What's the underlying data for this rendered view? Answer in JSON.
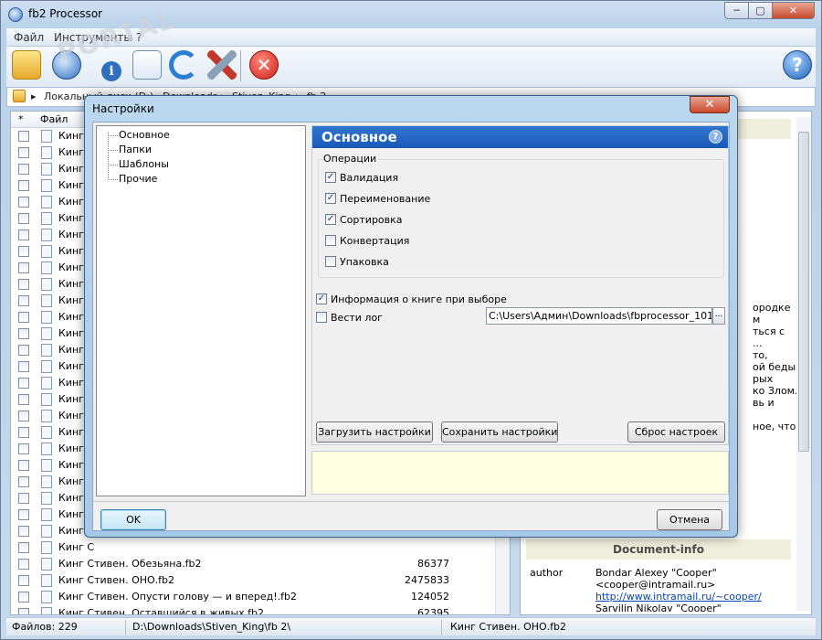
{
  "window": {
    "title": "fb2 Processor",
    "min": "─",
    "max": "▢",
    "close": "✕"
  },
  "menu": [
    "Файл",
    "Инструменты",
    "?"
  ],
  "toolbar": {
    "info": "i",
    "stop": "✕",
    "help": "?"
  },
  "address": {
    "crumbs": [
      "Локальный диск (D:)",
      "Downloads",
      "Stiven_King",
      "fb 2"
    ],
    "sep": "▸"
  },
  "filelist": {
    "headers": {
      "check": "*",
      "name": "Файл"
    },
    "rows": [
      {
        "name": "Кинг С",
        "size": ""
      },
      {
        "name": "Кинг С",
        "size": ""
      },
      {
        "name": "Кинг С",
        "size": ""
      },
      {
        "name": "Кинг С",
        "size": ""
      },
      {
        "name": "Кинг С",
        "size": ""
      },
      {
        "name": "Кинг С",
        "size": ""
      },
      {
        "name": "Кинг С",
        "size": ""
      },
      {
        "name": "Кинг С",
        "size": ""
      },
      {
        "name": "Кинг С",
        "size": ""
      },
      {
        "name": "Кинг С",
        "size": ""
      },
      {
        "name": "Кинг С",
        "size": ""
      },
      {
        "name": "Кинг С",
        "size": ""
      },
      {
        "name": "Кинг С",
        "size": ""
      },
      {
        "name": "Кинг С",
        "size": ""
      },
      {
        "name": "Кинг С",
        "size": ""
      },
      {
        "name": "Кинг С",
        "size": ""
      },
      {
        "name": "Кинг С",
        "size": ""
      },
      {
        "name": "Кинг С",
        "size": ""
      },
      {
        "name": "Кинг С",
        "size": ""
      },
      {
        "name": "Кинг С",
        "size": ""
      },
      {
        "name": "Кинг С",
        "size": ""
      },
      {
        "name": "Кинг С",
        "size": ""
      },
      {
        "name": "Кинг С",
        "size": ""
      },
      {
        "name": "Кинг С",
        "size": ""
      },
      {
        "name": "Кинг С",
        "size": ""
      },
      {
        "name": "Кинг С",
        "size": ""
      },
      {
        "name": "Кинг Стивен. Обезьяна.fb2",
        "size": "86377"
      },
      {
        "name": "Кинг Стивен. ОНО.fb2",
        "size": "2475833"
      },
      {
        "name": "Кинг Стивен. Опусти голову — и вперед!.fb2",
        "size": "124052"
      },
      {
        "name": "Кинг Стивен. Оставшийся в живых.fb2",
        "size": "62395"
      }
    ]
  },
  "rightpanel": {
    "lines": [
      "ородке",
      "м",
      "ться с",
      "...",
      "то,",
      "ой беды.",
      "рых",
      "ко Злом.",
      "вь и",
      "",
      "ное, что"
    ],
    "docinfo_title": "Document-info",
    "author_label": "author",
    "author_lines": [
      "Bondar Alexey \"Cooper\"",
      "<cooper@intramail.ru>",
      "http://www.intramail.ru/~cooper/",
      "Sarvilin Nikolay \"Cooper\""
    ]
  },
  "status": {
    "files": "Файлов: 229",
    "path": "D:\\Downloads\\Stiven_King\\fb 2\\",
    "current": "Кинг Стивен. ОНО.fb2"
  },
  "dialog": {
    "title": "Настройки",
    "close": "✕",
    "tree": [
      "Основное",
      "Папки",
      "Шаблоны",
      "Прочие"
    ],
    "section_title": "Основное",
    "section_help": "?",
    "group_label": "Операции",
    "operations": [
      {
        "label": "Валидация",
        "checked": true
      },
      {
        "label": "Переименование",
        "checked": true
      },
      {
        "label": "Сортировка",
        "checked": true
      },
      {
        "label": "Конвертация",
        "checked": false
      },
      {
        "label": "Упаковка",
        "checked": false
      }
    ],
    "book_info": {
      "label": "Информация о книге при выборе",
      "checked": true
    },
    "log": {
      "label": "Вести лог",
      "checked": false,
      "path": "C:\\Users\\Админ\\Downloads\\fbprocessor_101\\log.txt",
      "browse": "..."
    },
    "buttons": {
      "load": "Загрузить настройки",
      "save": "Сохранить настройки",
      "reset": "Сброс настроек",
      "ok": "OK",
      "cancel": "Отмена"
    }
  },
  "watermark": "PORTAL"
}
